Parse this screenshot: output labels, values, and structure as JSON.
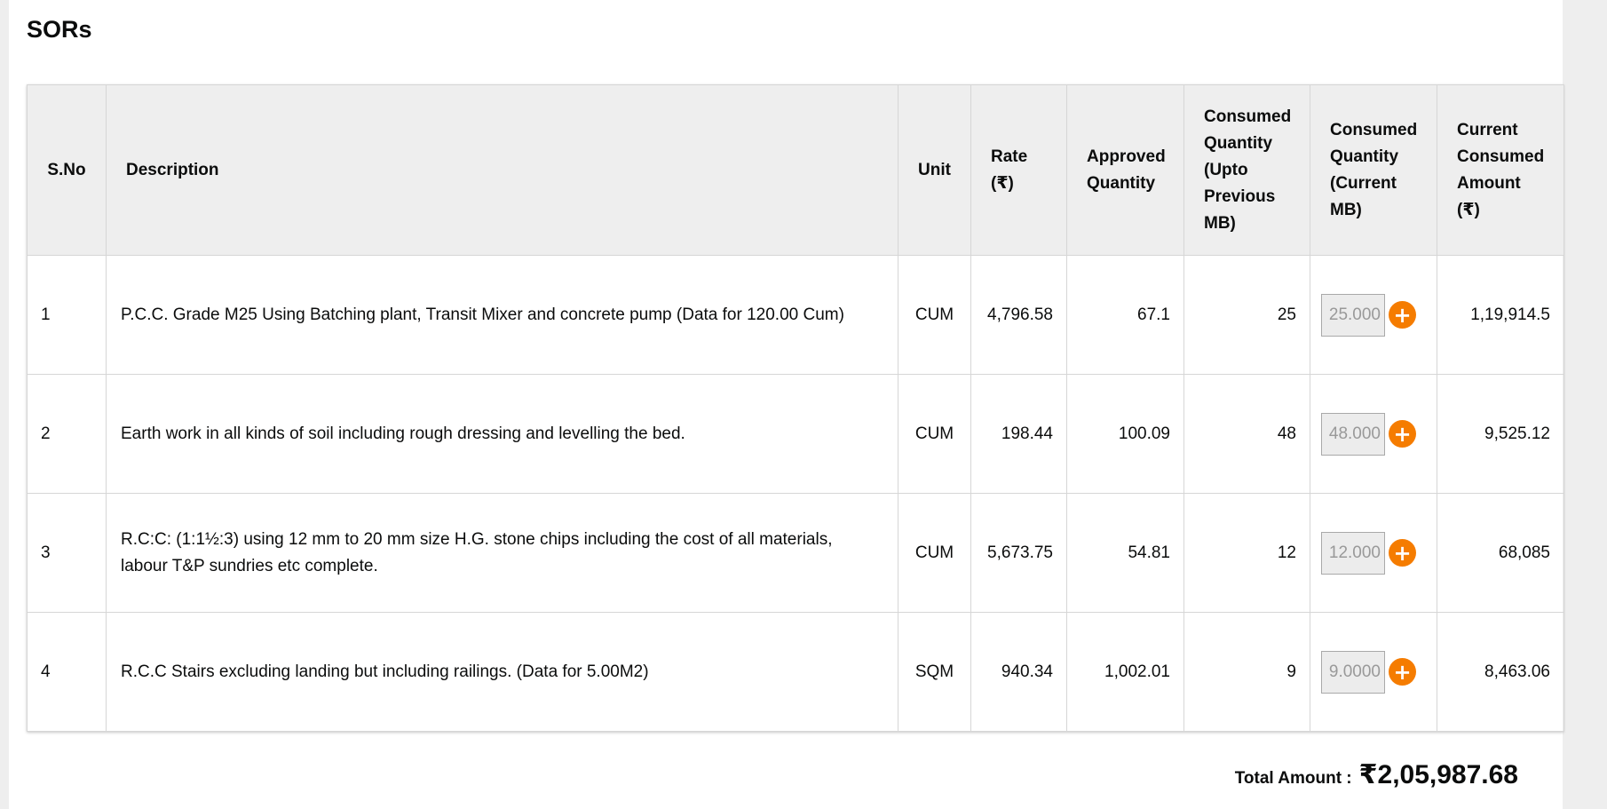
{
  "page": {
    "title": "SORs"
  },
  "table": {
    "headers": {
      "sno": "S.No",
      "description": "Description",
      "unit": "Unit",
      "rate": "Rate (₹)",
      "approved_qty": "Approved Quantity",
      "consumed_prev": "Consumed Quantity (Upto Previous MB)",
      "consumed_current": "Consumed Quantity (Current MB)",
      "current_amount": "Current Consumed Amount (₹)"
    },
    "rows": [
      {
        "sno": "1",
        "description": "P.C.C. Grade M25 Using Batching plant, Transit Mixer and concrete pump (Data for 120.00 Cum)",
        "unit": "CUM",
        "rate": "4,796.58",
        "approved_qty": "67.1",
        "consumed_prev": "25",
        "consumed_current": "25.000",
        "current_amount": "1,19,914.5"
      },
      {
        "sno": "2",
        "description": "Earth work in all kinds of soil including rough dressing and levelling the bed.",
        "unit": "CUM",
        "rate": "198.44",
        "approved_qty": "100.09",
        "consumed_prev": "48",
        "consumed_current": "48.000",
        "current_amount": "9,525.12"
      },
      {
        "sno": "3",
        "description": "R.C:C: (1:1½:3) using 12 mm to 20 mm size H.G. stone chips including the cost of all materials, labour T&P sundries etc complete.",
        "unit": "CUM",
        "rate": "5,673.75",
        "approved_qty": "54.81",
        "consumed_prev": "12",
        "consumed_current": "12.000",
        "current_amount": "68,085"
      },
      {
        "sno": "4",
        "description": "R.C.C Stairs excluding landing but including railings. (Data for 5.00M2)",
        "unit": "SQM",
        "rate": "940.34",
        "approved_qty": "1,002.01",
        "consumed_prev": "9",
        "consumed_current": "9.0000",
        "current_amount": "8,463.06"
      }
    ],
    "add_icon": "plus-icon",
    "add_label": "+"
  },
  "total": {
    "label": "Total Amount :",
    "value": "₹2,05,987.68"
  },
  "colors": {
    "accent": "#f57c00",
    "header_bg": "#eeeeee",
    "border": "#d6d6d6",
    "page_bg": "#eeeeee",
    "input_bg": "#ececec"
  }
}
